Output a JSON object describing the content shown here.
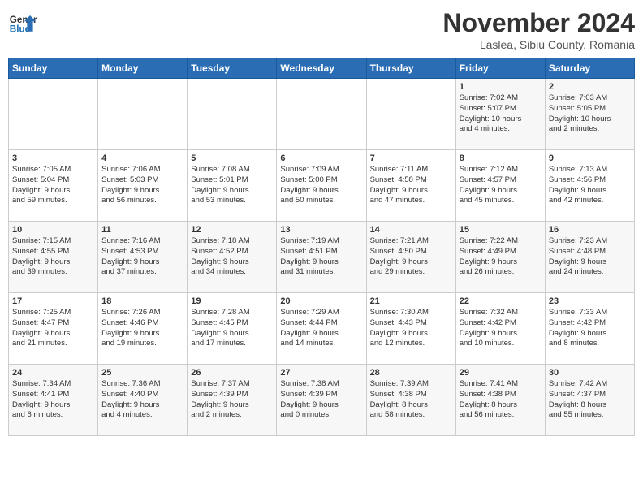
{
  "logo": {
    "line1": "General",
    "line2": "Blue"
  },
  "title": "November 2024",
  "location": "Laslea, Sibiu County, Romania",
  "weekdays": [
    "Sunday",
    "Monday",
    "Tuesday",
    "Wednesday",
    "Thursday",
    "Friday",
    "Saturday"
  ],
  "weeks": [
    [
      {
        "day": "",
        "info": ""
      },
      {
        "day": "",
        "info": ""
      },
      {
        "day": "",
        "info": ""
      },
      {
        "day": "",
        "info": ""
      },
      {
        "day": "",
        "info": ""
      },
      {
        "day": "1",
        "info": "Sunrise: 7:02 AM\nSunset: 5:07 PM\nDaylight: 10 hours\nand 4 minutes."
      },
      {
        "day": "2",
        "info": "Sunrise: 7:03 AM\nSunset: 5:05 PM\nDaylight: 10 hours\nand 2 minutes."
      }
    ],
    [
      {
        "day": "3",
        "info": "Sunrise: 7:05 AM\nSunset: 5:04 PM\nDaylight: 9 hours\nand 59 minutes."
      },
      {
        "day": "4",
        "info": "Sunrise: 7:06 AM\nSunset: 5:03 PM\nDaylight: 9 hours\nand 56 minutes."
      },
      {
        "day": "5",
        "info": "Sunrise: 7:08 AM\nSunset: 5:01 PM\nDaylight: 9 hours\nand 53 minutes."
      },
      {
        "day": "6",
        "info": "Sunrise: 7:09 AM\nSunset: 5:00 PM\nDaylight: 9 hours\nand 50 minutes."
      },
      {
        "day": "7",
        "info": "Sunrise: 7:11 AM\nSunset: 4:58 PM\nDaylight: 9 hours\nand 47 minutes."
      },
      {
        "day": "8",
        "info": "Sunrise: 7:12 AM\nSunset: 4:57 PM\nDaylight: 9 hours\nand 45 minutes."
      },
      {
        "day": "9",
        "info": "Sunrise: 7:13 AM\nSunset: 4:56 PM\nDaylight: 9 hours\nand 42 minutes."
      }
    ],
    [
      {
        "day": "10",
        "info": "Sunrise: 7:15 AM\nSunset: 4:55 PM\nDaylight: 9 hours\nand 39 minutes."
      },
      {
        "day": "11",
        "info": "Sunrise: 7:16 AM\nSunset: 4:53 PM\nDaylight: 9 hours\nand 37 minutes."
      },
      {
        "day": "12",
        "info": "Sunrise: 7:18 AM\nSunset: 4:52 PM\nDaylight: 9 hours\nand 34 minutes."
      },
      {
        "day": "13",
        "info": "Sunrise: 7:19 AM\nSunset: 4:51 PM\nDaylight: 9 hours\nand 31 minutes."
      },
      {
        "day": "14",
        "info": "Sunrise: 7:21 AM\nSunset: 4:50 PM\nDaylight: 9 hours\nand 29 minutes."
      },
      {
        "day": "15",
        "info": "Sunrise: 7:22 AM\nSunset: 4:49 PM\nDaylight: 9 hours\nand 26 minutes."
      },
      {
        "day": "16",
        "info": "Sunrise: 7:23 AM\nSunset: 4:48 PM\nDaylight: 9 hours\nand 24 minutes."
      }
    ],
    [
      {
        "day": "17",
        "info": "Sunrise: 7:25 AM\nSunset: 4:47 PM\nDaylight: 9 hours\nand 21 minutes."
      },
      {
        "day": "18",
        "info": "Sunrise: 7:26 AM\nSunset: 4:46 PM\nDaylight: 9 hours\nand 19 minutes."
      },
      {
        "day": "19",
        "info": "Sunrise: 7:28 AM\nSunset: 4:45 PM\nDaylight: 9 hours\nand 17 minutes."
      },
      {
        "day": "20",
        "info": "Sunrise: 7:29 AM\nSunset: 4:44 PM\nDaylight: 9 hours\nand 14 minutes."
      },
      {
        "day": "21",
        "info": "Sunrise: 7:30 AM\nSunset: 4:43 PM\nDaylight: 9 hours\nand 12 minutes."
      },
      {
        "day": "22",
        "info": "Sunrise: 7:32 AM\nSunset: 4:42 PM\nDaylight: 9 hours\nand 10 minutes."
      },
      {
        "day": "23",
        "info": "Sunrise: 7:33 AM\nSunset: 4:42 PM\nDaylight: 9 hours\nand 8 minutes."
      }
    ],
    [
      {
        "day": "24",
        "info": "Sunrise: 7:34 AM\nSunset: 4:41 PM\nDaylight: 9 hours\nand 6 minutes."
      },
      {
        "day": "25",
        "info": "Sunrise: 7:36 AM\nSunset: 4:40 PM\nDaylight: 9 hours\nand 4 minutes."
      },
      {
        "day": "26",
        "info": "Sunrise: 7:37 AM\nSunset: 4:39 PM\nDaylight: 9 hours\nand 2 minutes."
      },
      {
        "day": "27",
        "info": "Sunrise: 7:38 AM\nSunset: 4:39 PM\nDaylight: 9 hours\nand 0 minutes."
      },
      {
        "day": "28",
        "info": "Sunrise: 7:39 AM\nSunset: 4:38 PM\nDaylight: 8 hours\nand 58 minutes."
      },
      {
        "day": "29",
        "info": "Sunrise: 7:41 AM\nSunset: 4:38 PM\nDaylight: 8 hours\nand 56 minutes."
      },
      {
        "day": "30",
        "info": "Sunrise: 7:42 AM\nSunset: 4:37 PM\nDaylight: 8 hours\nand 55 minutes."
      }
    ]
  ]
}
